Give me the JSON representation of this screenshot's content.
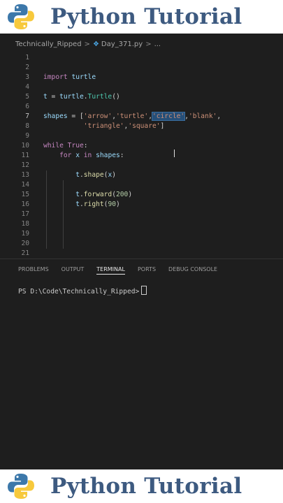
{
  "banner": {
    "title": "Python Tutorial"
  },
  "breadcrumb": {
    "folder": "Technically_Ripped",
    "file": "Day_371.py",
    "more": "..."
  },
  "editor": {
    "lines": [
      {
        "n": "1",
        "code": ""
      },
      {
        "n": "2",
        "code": ""
      },
      {
        "n": "3",
        "code": "import turtle"
      },
      {
        "n": "4",
        "code": ""
      },
      {
        "n": "5",
        "code": "t = turtle.Turtle()"
      },
      {
        "n": "6",
        "code": ""
      },
      {
        "n": "7",
        "code": "shapes = ['arrow','turtle','circle','blank',"
      },
      {
        "n": "8",
        "code": "          'triangle','square']"
      },
      {
        "n": "9",
        "code": ""
      },
      {
        "n": "10",
        "code": "while True:"
      },
      {
        "n": "11",
        "code": "    for x in shapes:"
      },
      {
        "n": "12",
        "code": ""
      },
      {
        "n": "13",
        "code": "        t.shape(x)"
      },
      {
        "n": "14",
        "code": ""
      },
      {
        "n": "15",
        "code": "        t.forward(200)"
      },
      {
        "n": "16",
        "code": "        t.right(90)"
      },
      {
        "n": "17",
        "code": ""
      },
      {
        "n": "18",
        "code": ""
      },
      {
        "n": "19",
        "code": ""
      },
      {
        "n": "20",
        "code": ""
      },
      {
        "n": "21",
        "code": ""
      }
    ],
    "selected_text": "'circle'",
    "active_line": "7"
  },
  "panel": {
    "tabs": [
      "PROBLEMS",
      "OUTPUT",
      "TERMINAL",
      "PORTS",
      "DEBUG CONSOLE"
    ],
    "active_tab": "TERMINAL",
    "prompt": "PS D:\\Code\\Technically_Ripped>"
  },
  "icons": {
    "logo": "python-logo-icon",
    "file": "python-file-icon"
  },
  "colors": {
    "banner_title": "#3d5a80",
    "editor_bg": "#1e1e1e",
    "keyword": "#c586c0",
    "string": "#ce9178",
    "selection": "#264f78"
  }
}
